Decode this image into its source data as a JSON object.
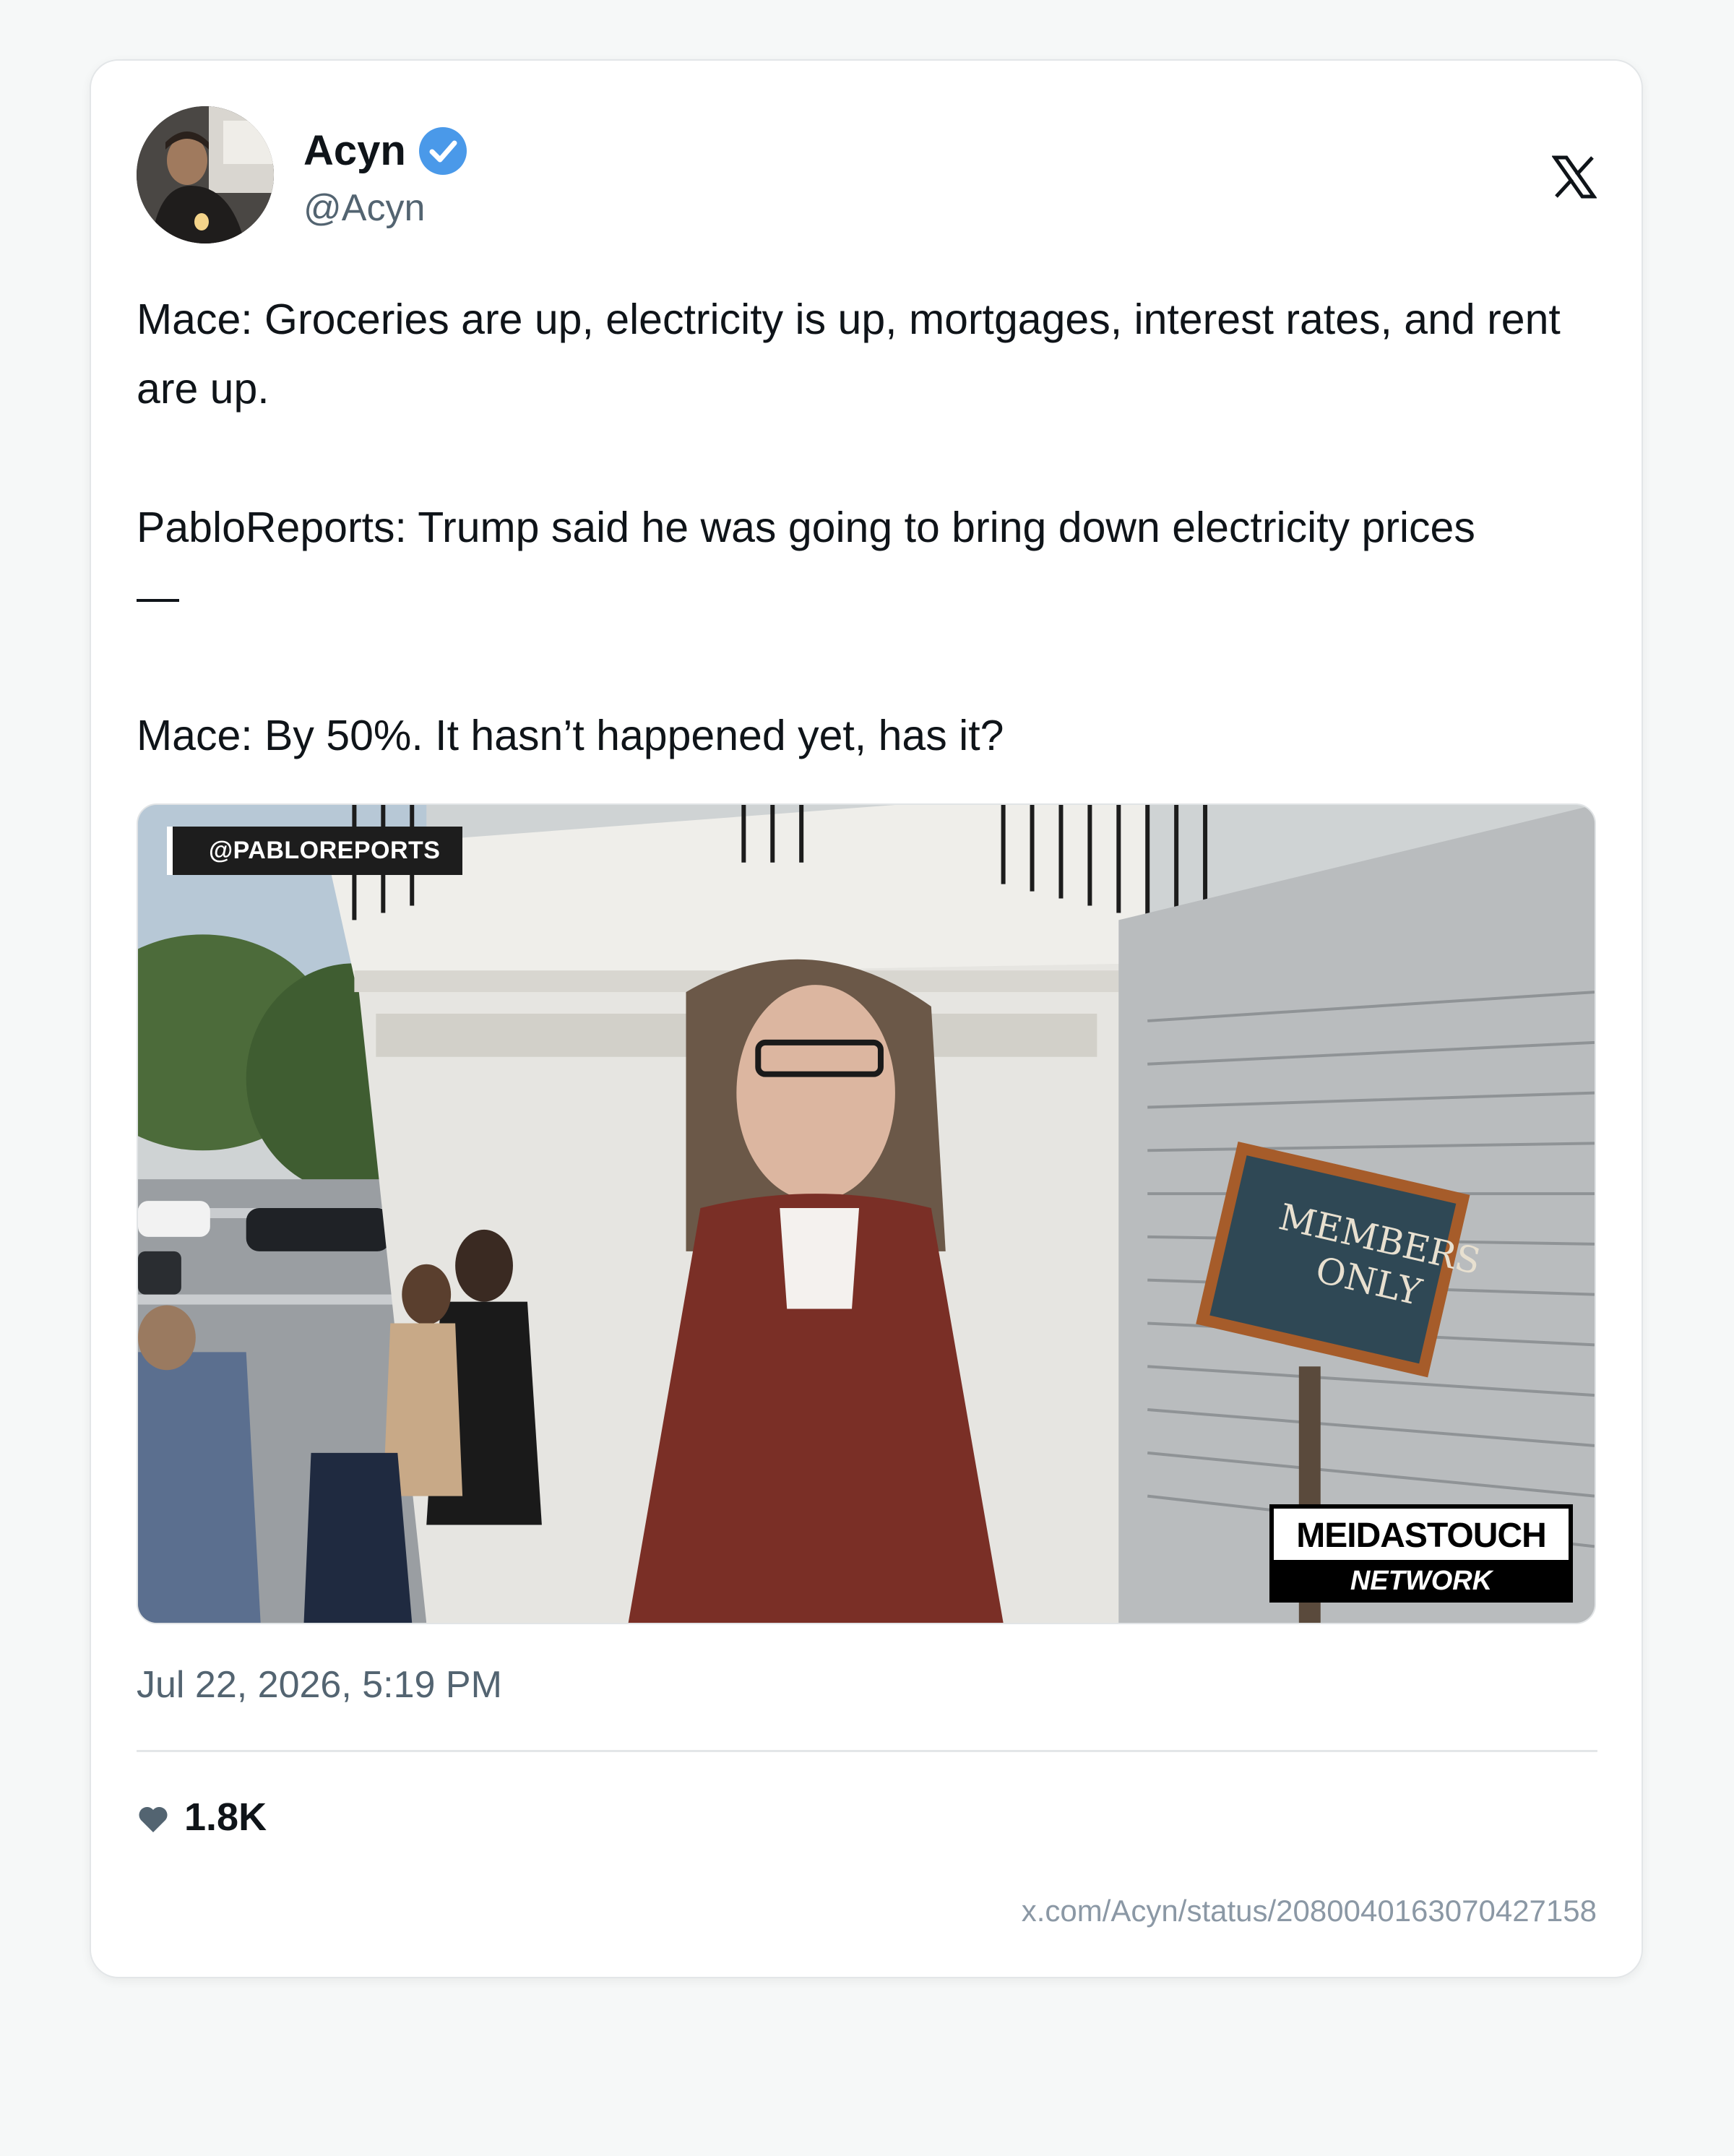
{
  "author": {
    "display_name": "Acyn",
    "handle": "@Acyn",
    "verified": true
  },
  "platform": {
    "logo": "x-logo-icon"
  },
  "tweet": {
    "text": "Mace: Groceries are up, electricity is up, mortgages, interest rates, and rent are up.\n\nPabloReports: Trump said he was going to bring down electricity prices\n—\n\nMace: By 50%. It hasn’t happened yet, has it?"
  },
  "media": {
    "watermark_top_left": "@PABLOREPORTS",
    "sign_text": "MEMBERS\nONLY",
    "network_badge_top": "MEIDASTOUCH",
    "network_badge_bottom": "NETWORK"
  },
  "timestamp": "Jul 22, 2026, 5:19 PM",
  "engagement": {
    "likes_icon": "heart-icon",
    "likes": "1.8K"
  },
  "status_url": "x.com/Acyn/status/2080040163070427158",
  "colors": {
    "verified_badge": "#4a99e9",
    "text_primary": "#0f1419",
    "text_secondary": "#536471"
  }
}
